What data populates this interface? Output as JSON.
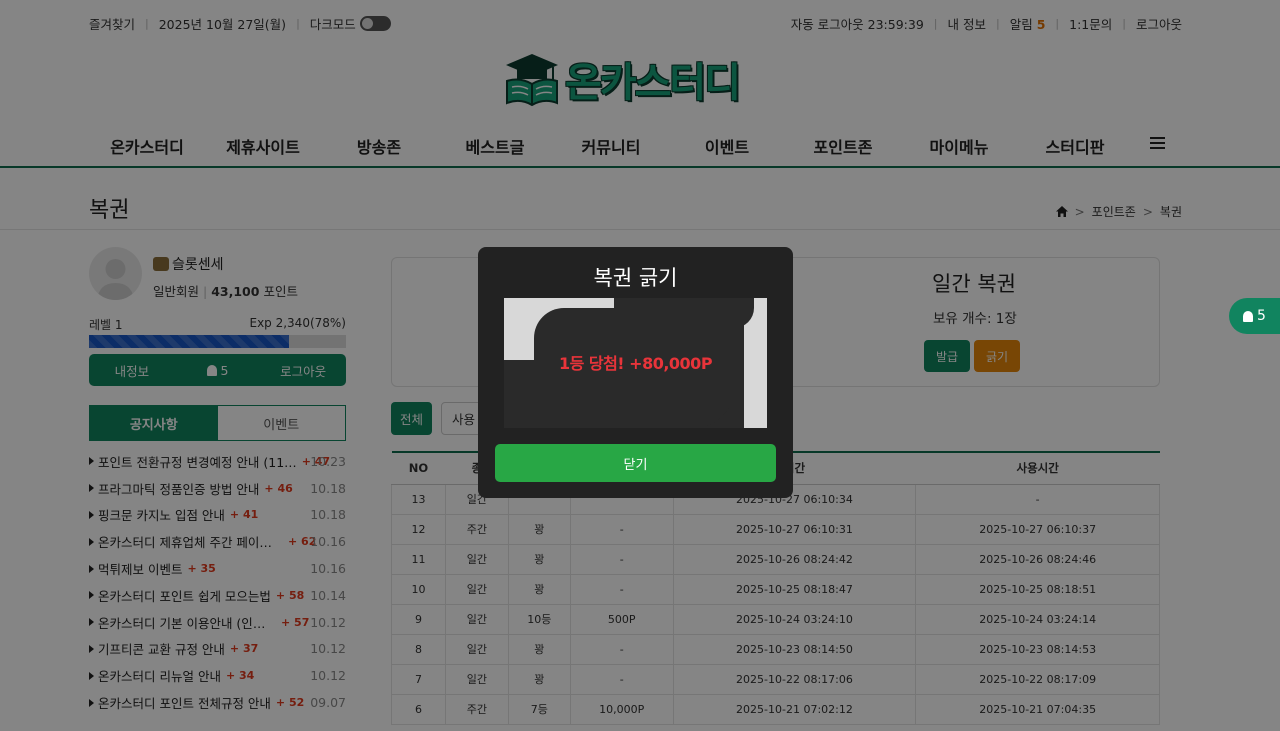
{
  "topbar": {
    "bookmark": "즐겨찾기",
    "date": "2025년 10월 27일(월)",
    "darkmode_label": "다크모드",
    "auto_logout": "자동 로그아웃 23:59:39",
    "my_info": "내 정보",
    "alarm_label": "알림",
    "alarm_count": "5",
    "inquiry": "1:1문의",
    "logout": "로그아웃"
  },
  "logo": {
    "text": "온카스터디"
  },
  "nav": {
    "items": [
      "온카스터디",
      "제휴사이트",
      "방송존",
      "베스트글",
      "커뮤니티",
      "이벤트",
      "포인트존",
      "마이메뉴",
      "스터디판"
    ]
  },
  "page": {
    "title": "복권",
    "breadcrumb": [
      "포인트존",
      "복권"
    ]
  },
  "profile": {
    "username": "슬롯센세",
    "grade": "일반회원",
    "points": "43,100",
    "points_unit": "포인트",
    "level": "레벨 1",
    "exp": "Exp 2,340(78%)",
    "exp_progress": 0.78,
    "buttons": {
      "info": "내정보",
      "alarm": "5",
      "logout": "로그아웃"
    }
  },
  "tabs": {
    "notice": "공지사항",
    "event": "이벤트"
  },
  "notices": [
    {
      "title": "포인트 전환규정 변경예정 안내 (11…",
      "count": "+ 47",
      "date": "10.23"
    },
    {
      "title": "프라그마틱 정품인증 방법 안내",
      "count": "+ 46",
      "date": "10.18"
    },
    {
      "title": "핑크문 카지노 입점 안내",
      "count": "+ 41",
      "date": "10.18"
    },
    {
      "title": "온카스터디 제휴업체 주간 페이백 …",
      "count": "+ 62",
      "date": "10.16"
    },
    {
      "title": "먹튀제보 이벤트",
      "count": "+ 35",
      "date": "10.16"
    },
    {
      "title": "온카스터디 포인트 쉽게 모으는법",
      "count": "+ 58",
      "date": "10.14"
    },
    {
      "title": "온카스터디 기본 이용안내 (인증레…",
      "count": "+ 57",
      "date": "10.12"
    },
    {
      "title": "기프티콘 교환 규정 안내",
      "count": "+ 37",
      "date": "10.12"
    },
    {
      "title": "온카스터디 리뉴얼 안내",
      "count": "+ 34",
      "date": "10.12"
    },
    {
      "title": "온카스터디 포인트 전체규정 안내",
      "count": "+ 52",
      "date": "09.07"
    }
  ],
  "lotto": {
    "title": "일간 복권",
    "owned": "보유 개수: 1장",
    "issue_btn": "발급",
    "scratch_btn": "긁기"
  },
  "filters": {
    "all": "전체",
    "used": "사용"
  },
  "table": {
    "headers": [
      "NO",
      "종",
      "",
      "",
      "시간",
      "사용시간"
    ],
    "rows": [
      [
        "13",
        "일간",
        "",
        "",
        "2025-10-27 06:10:34",
        "-"
      ],
      [
        "12",
        "주간",
        "꽝",
        "-",
        "2025-10-27 06:10:31",
        "2025-10-27 06:10:37"
      ],
      [
        "11",
        "일간",
        "꽝",
        "-",
        "2025-10-26 08:24:42",
        "2025-10-26 08:24:46"
      ],
      [
        "10",
        "일간",
        "꽝",
        "-",
        "2025-10-25 08:18:47",
        "2025-10-25 08:18:51"
      ],
      [
        "9",
        "일간",
        "10등",
        "500P",
        "2025-10-24 03:24:10",
        "2025-10-24 03:24:14"
      ],
      [
        "8",
        "일간",
        "꽝",
        "-",
        "2025-10-23 08:14:50",
        "2025-10-23 08:14:53"
      ],
      [
        "7",
        "일간",
        "꽝",
        "-",
        "2025-10-22 08:17:06",
        "2025-10-22 08:17:09"
      ],
      [
        "6",
        "주간",
        "7등",
        "10,000P",
        "2025-10-21 07:02:12",
        "2025-10-21 07:04:35"
      ]
    ]
  },
  "float_alarm": {
    "count": "5"
  },
  "modal": {
    "title": "복권 긁기",
    "prize": "1등 당첨! +80,000P",
    "close": "닫기"
  },
  "colors": {
    "brand": "#11845f",
    "accent": "#e6870b",
    "close_btn": "#28a745",
    "prize": "#e8343a"
  }
}
